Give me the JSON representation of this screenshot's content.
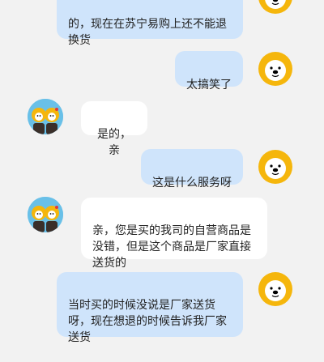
{
  "messages": [
    {
      "side": "mine",
      "text": "的，现在在苏宁易购上还不能退\n换货"
    },
    {
      "side": "mine",
      "text": "太搞笑了"
    },
    {
      "side": "theirs",
      "text": "是的，亲"
    },
    {
      "side": "mine",
      "text": "这是什么服务呀"
    },
    {
      "side": "theirs",
      "text": "亲，您是买的我司的自营商品是\n没错，但是这个商品是厂家直接\n送货的"
    },
    {
      "side": "mine",
      "text": "当时买的时候没说是厂家送货\n呀，现在想退的时候告诉我厂家\n送货"
    }
  ],
  "colors": {
    "background": "#f2f2f2",
    "mine_bubble": "#cfe4fb",
    "theirs_bubble": "#ffffff",
    "lion": "#f5b60c"
  },
  "icons": {
    "user_avatar": "lion-avatar-icon",
    "agent_avatar": "twin-mascot-avatar-icon"
  }
}
